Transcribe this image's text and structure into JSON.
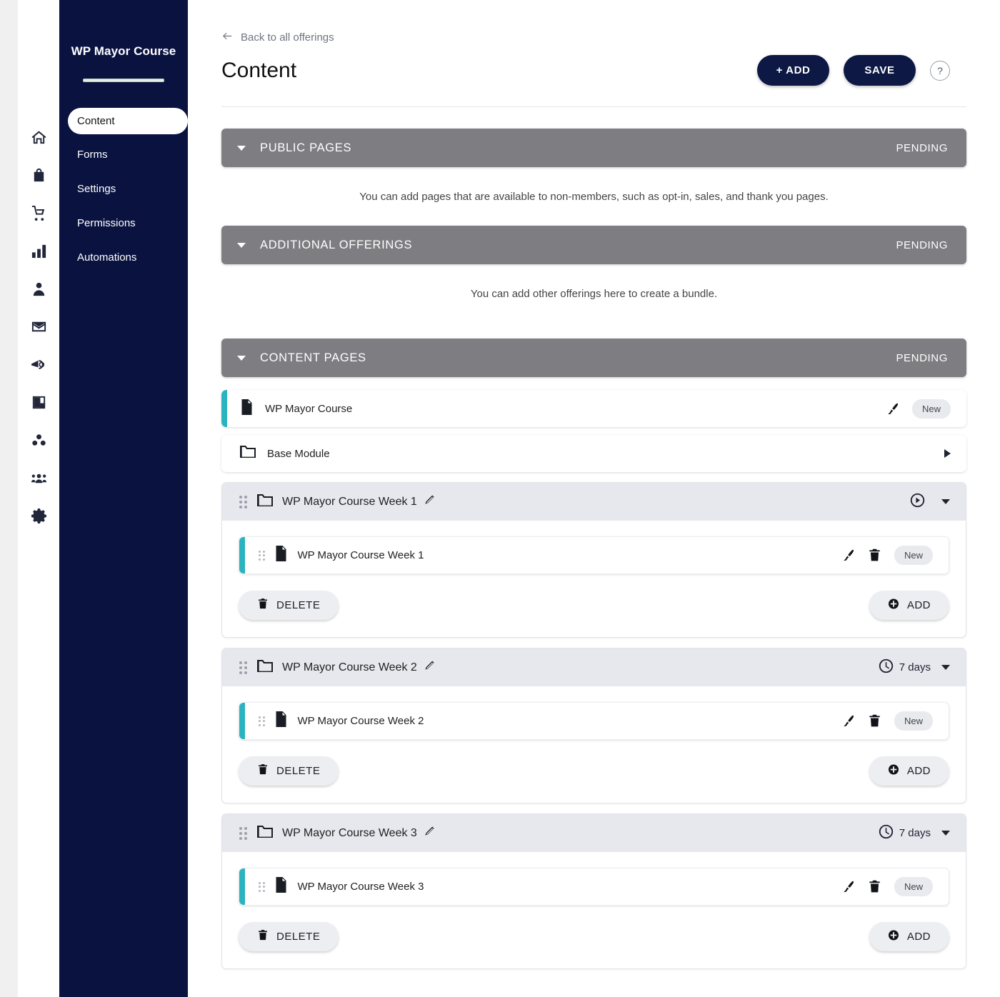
{
  "rail": {
    "icons": [
      {
        "name": "home-icon"
      },
      {
        "name": "store-icon"
      },
      {
        "name": "cart-icon"
      },
      {
        "name": "bar-chart-icon"
      },
      {
        "name": "person-icon"
      },
      {
        "name": "envelope-icon"
      },
      {
        "name": "megaphone-icon"
      },
      {
        "name": "book-icon"
      },
      {
        "name": "group-dots-icon"
      },
      {
        "name": "community-icon"
      },
      {
        "name": "gear-icon"
      }
    ]
  },
  "sidebar": {
    "brand": "WP Mayor Course",
    "items": [
      {
        "label": "Content",
        "active": true
      },
      {
        "label": "Forms",
        "active": false
      },
      {
        "label": "Settings",
        "active": false
      },
      {
        "label": "Permissions",
        "active": false
      },
      {
        "label": "Automations",
        "active": false
      }
    ]
  },
  "header": {
    "back_label": "Back to all offerings",
    "title": "Content",
    "add_label": "+ ADD",
    "save_label": "SAVE",
    "help_label": "?"
  },
  "sections": [
    {
      "title": "PUBLIC PAGES",
      "status": "PENDING",
      "note": "You can add pages that are available to non-members, such as opt-in, sales, and thank you pages."
    },
    {
      "title": "ADDITIONAL OFFERINGS",
      "status": "PENDING",
      "note": "You can add other offerings here to create a bundle."
    },
    {
      "title": "CONTENT PAGES",
      "status": "PENDING",
      "note": ""
    }
  ],
  "content_pages": {
    "top_rows": [
      {
        "name": "WP Mayor Course",
        "icon": "document-icon",
        "badge": "New",
        "accent": "#2bb3bf"
      },
      {
        "name": "Base Module",
        "icon": "folder-icon",
        "badge": "",
        "accent": ""
      }
    ],
    "modules": [
      {
        "title": "WP Mayor Course Week 1",
        "timing": "",
        "timing_icon": "play-circle-icon",
        "rows": [
          {
            "name": "WP Mayor Course Week 1",
            "badge": "New"
          }
        ],
        "delete_label": "DELETE",
        "add_label": "ADD"
      },
      {
        "title": "WP Mayor Course Week 2",
        "timing": "7 days",
        "timing_icon": "clock-icon",
        "rows": [
          {
            "name": "WP Mayor Course Week 2",
            "badge": "New"
          }
        ],
        "delete_label": "DELETE",
        "add_label": "ADD"
      },
      {
        "title": "WP Mayor Course Week 3",
        "timing": "7 days",
        "timing_icon": "clock-icon",
        "rows": [
          {
            "name": "WP Mayor Course Week 3",
            "badge": "New"
          }
        ],
        "delete_label": "DELETE",
        "add_label": "ADD"
      }
    ]
  },
  "colors": {
    "sidebar_bg": "#0a1340",
    "accent_teal": "#2bb3bf",
    "section_gray": "#7e7e82",
    "button_navy": "#0d1845"
  }
}
